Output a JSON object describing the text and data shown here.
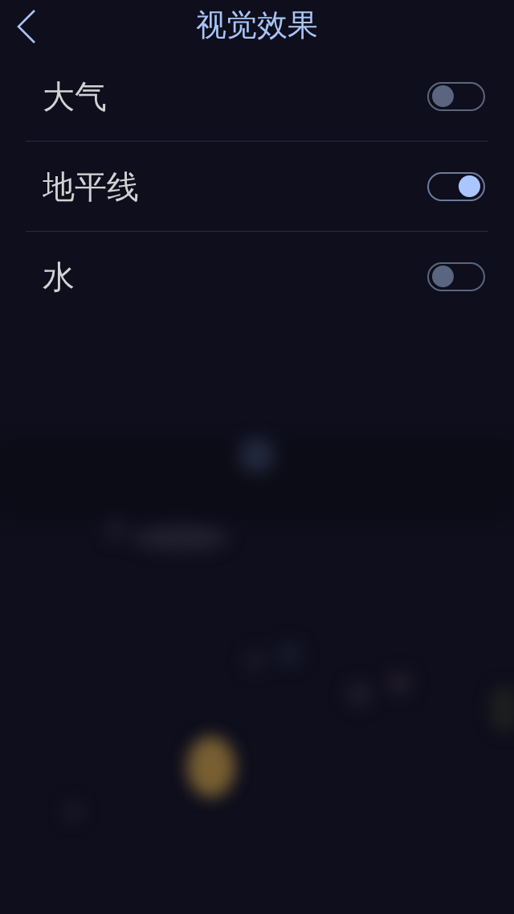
{
  "header": {
    "title": "视觉效果"
  },
  "settings": [
    {
      "label": "大气",
      "on": false
    },
    {
      "label": "地平线",
      "on": true
    },
    {
      "label": "水",
      "on": false
    }
  ]
}
